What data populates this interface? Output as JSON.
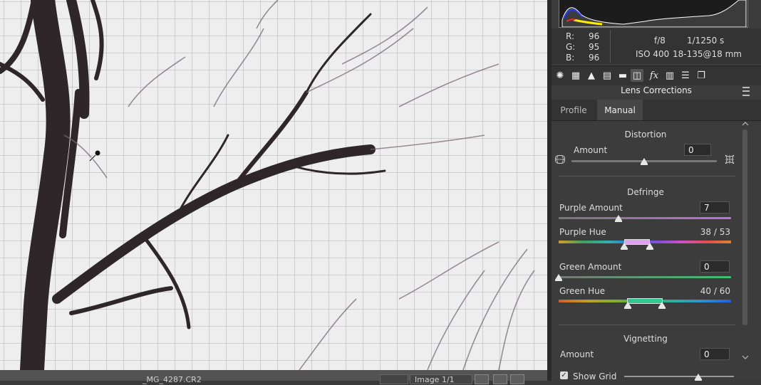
{
  "status_bar": {
    "filename": "_MG_4287.CR2",
    "image_count": "Image 1/1"
  },
  "readout": {
    "r_label": "R:",
    "r_value": "96",
    "g_label": "G:",
    "g_value": "95",
    "b_label": "B:",
    "b_value": "96",
    "aperture": "f/8",
    "shutter": "1/1250 s",
    "iso": "ISO 400",
    "lens": "18-135@18 mm"
  },
  "panel": {
    "title": "Lens Corrections",
    "tabs": [
      {
        "label": "Profile"
      },
      {
        "label": "Manual"
      }
    ],
    "active_tab": "Manual",
    "distortion": {
      "heading": "Distortion",
      "amount_label": "Amount",
      "amount_value": "0",
      "slider_position": 0.5
    },
    "defringe": {
      "heading": "Defringe",
      "purple_amount_label": "Purple Amount",
      "purple_amount_value": "7",
      "purple_amount_slider": 0.35,
      "purple_hue_label": "Purple Hue",
      "purple_hue_value": "38 / 53",
      "purple_hue_range": [
        38,
        53
      ],
      "green_amount_label": "Green Amount",
      "green_amount_value": "0",
      "green_amount_slider": 0.0,
      "green_hue_label": "Green Hue",
      "green_hue_value": "40 / 60",
      "green_hue_range": [
        40,
        60
      ]
    },
    "vignetting": {
      "heading": "Vignetting",
      "amount_label": "Amount",
      "amount_value": "0"
    }
  },
  "bottom": {
    "show_grid_label": "Show Grid",
    "show_grid_checked": true
  },
  "icons": [
    "aperture-icon",
    "grid-curve-icon",
    "mountains-icon",
    "split-tone-icon",
    "hsl-icon",
    "lens-corrections-icon",
    "fx-icon",
    "camera-calibration-icon",
    "presets-icon",
    "snapshots-icon"
  ],
  "colors": {
    "panel_bg": "#3c3c3c",
    "purple": "#b070d0",
    "green": "#3ec070"
  }
}
